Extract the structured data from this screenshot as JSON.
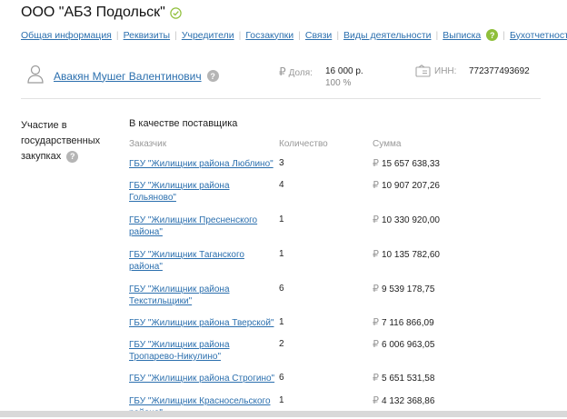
{
  "company": {
    "title": "ООО \"АБЗ Подольск\""
  },
  "nav": [
    "Общая информация",
    "Реквизиты",
    "Учредители",
    "Госзакупки",
    "Связи",
    "Виды деятельности",
    "Выписка",
    "Бухотчетность"
  ],
  "help_mark": "?",
  "owner": {
    "name": "Авакян Мушег Валентинович",
    "share_label": "Доля:",
    "share_value": "16 000 р.",
    "share_percent": "100 %",
    "inn_label": "ИНН:",
    "inn_value": "772377493692"
  },
  "procurement": {
    "section_label": "Участие в государственных закупках",
    "subtitle": "В качестве поставщика",
    "columns": [
      "Заказчик",
      "Количество",
      "Сумма"
    ],
    "rows": [
      {
        "customer": "ГБУ \"Жилищник района Люблино\"",
        "qty": "3",
        "sum": "15 657 638,33"
      },
      {
        "customer": "ГБУ \"Жилищник района Гольяново\"",
        "qty": "4",
        "sum": "10 907 207,26"
      },
      {
        "customer": "ГБУ \"Жилищник Пресненского района\"",
        "qty": "1",
        "sum": "10 330 920,00"
      },
      {
        "customer": "ГБУ \"Жилищник Таганского района\"",
        "qty": "1",
        "sum": "10 135 782,60"
      },
      {
        "customer": "ГБУ \"Жилищник района Текстильщики\"",
        "qty": "6",
        "sum": "9 539 178,75"
      },
      {
        "customer": "ГБУ \"Жилищник района Тверской\"",
        "qty": "1",
        "sum": "7 116 866,09"
      },
      {
        "customer": "ГБУ \"Жилищник района Тропарево-Никулино\"",
        "qty": "2",
        "sum": "6 006 963,05"
      },
      {
        "customer": "ГБУ \"Жилищник района Строгино\"",
        "qty": "6",
        "sum": "5 651 531,58"
      },
      {
        "customer": "ГБУ \"Жилищник Красносельского района\"",
        "qty": "1",
        "sum": "4 132 368,86"
      }
    ]
  },
  "currency_symbol": "₽",
  "colors": {
    "link": "#2b6fae",
    "accent_green": "#8fbf3a",
    "muted": "#999999"
  }
}
